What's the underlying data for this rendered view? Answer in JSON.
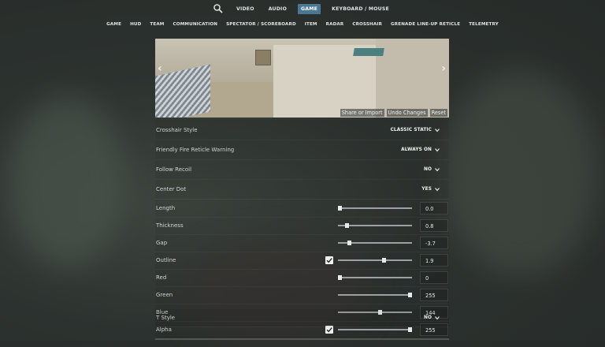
{
  "top_nav": {
    "search_icon": "search-icon",
    "tabs": [
      "VIDEO",
      "AUDIO",
      "GAME",
      "KEYBOARD / MOUSE"
    ],
    "active": "GAME"
  },
  "sub_nav": {
    "tabs": [
      "GAME",
      "HUD",
      "TEAM",
      "COMMUNICATION",
      "SPECTATOR / SCOREBOARD",
      "ITEM",
      "RADAR",
      "CROSSHAIR",
      "GRENADE LINE-UP RETICLE",
      "TELEMETRY"
    ]
  },
  "preview": {
    "share_label": "Share or Import",
    "undo_label": "Undo Changes",
    "reset_label": "Reset"
  },
  "settings": {
    "crosshair_style": {
      "label": "Crosshair Style",
      "value": "CLASSIC STATIC"
    },
    "friendly_fire": {
      "label": "Friendly Fire Reticle Warning",
      "value": "ALWAYS ON"
    },
    "follow_recoil": {
      "label": "Follow Recoil",
      "value": "NO"
    },
    "center_dot": {
      "label": "Center Dot",
      "value": "YES"
    },
    "length": {
      "label": "Length",
      "value": "0.0",
      "fraction": 0.02
    },
    "thickness": {
      "label": "Thickness",
      "value": "0.8",
      "fraction": 0.12
    },
    "gap": {
      "label": "Gap",
      "value": "-3.7",
      "fraction": 0.15
    },
    "outline": {
      "label": "Outline",
      "value": "1.9",
      "fraction": 0.62,
      "checked": true
    },
    "red": {
      "label": "Red",
      "value": "0",
      "fraction": 0.02
    },
    "green": {
      "label": "Green",
      "value": "255",
      "fraction": 0.97
    },
    "blue": {
      "label": "Blue",
      "value": "144",
      "fraction": 0.56
    },
    "alpha": {
      "label": "Alpha",
      "value": "255",
      "fraction": 0.97,
      "checked": true
    },
    "t_style": {
      "label": "T Style",
      "value": "NO"
    }
  }
}
